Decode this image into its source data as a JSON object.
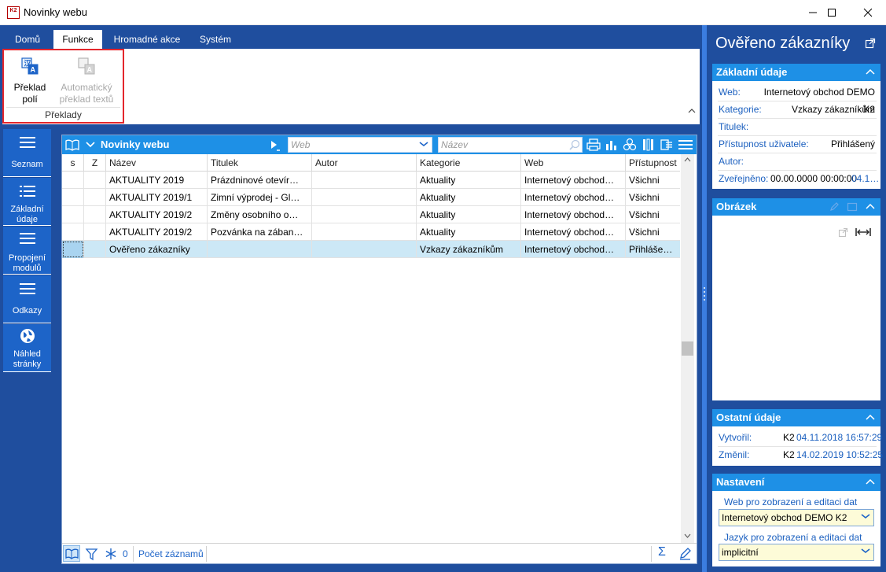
{
  "window": {
    "title": "Novinky webu",
    "app_icon_text": "K2"
  },
  "menu": {
    "tabs": [
      "Domů",
      "Funkce",
      "Hromadné akce",
      "Systém"
    ],
    "active": "Funkce"
  },
  "ribbon": {
    "buttons": [
      {
        "label1": "Překlad",
        "label2": "polí",
        "enabled": true
      },
      {
        "label1": "Automatický",
        "label2": "překlad textů",
        "enabled": false
      }
    ],
    "group_label": "Překlady"
  },
  "sidebar": {
    "items": [
      {
        "label": "Seznam",
        "icon": "menu-icon"
      },
      {
        "label1": "Základní",
        "label2": "údaje",
        "icon": "list-icon"
      },
      {
        "label1": "Propojení",
        "label2": "modulů",
        "icon": "menu-icon"
      },
      {
        "label": "Odkazy",
        "icon": "menu-icon"
      },
      {
        "label1": "Náhled",
        "label2": "stránky",
        "icon": "globe-icon"
      }
    ]
  },
  "grid": {
    "title": "Novinky webu",
    "filter_web_placeholder": "Web",
    "filter_name_placeholder": "Název",
    "columns": [
      "s",
      "Z",
      "Název",
      "Titulek",
      "Autor",
      "Kategorie",
      "Web",
      "Přístupnost"
    ],
    "rows": [
      {
        "nazev": "AKTUALITY 2019",
        "titulek": "Prázdninové otevír…",
        "autor": "",
        "kategorie": "Aktuality",
        "web": "Internetový obchod…",
        "pristupnost": "Všichni"
      },
      {
        "nazev": "AKTUALITY 2019/1",
        "titulek": "Zimní výprodej - Gl…",
        "autor": "",
        "kategorie": "Aktuality",
        "web": "Internetový obchod…",
        "pristupnost": "Všichni"
      },
      {
        "nazev": "AKTUALITY 2019/2",
        "titulek": "Změny osobního o…",
        "autor": "",
        "kategorie": "Aktuality",
        "web": "Internetový obchod…",
        "pristupnost": "Všichni"
      },
      {
        "nazev": "AKTUALITY 2019/2",
        "titulek": "Pozvánka na zában…",
        "autor": "",
        "kategorie": "Aktuality",
        "web": "Internetový obchod…",
        "pristupnost": "Všichni"
      },
      {
        "nazev": "Ověřeno zákazníky",
        "titulek": "",
        "autor": "",
        "kategorie": "Vzkazy zákazníkům",
        "web": "Internetový obchod…",
        "pristupnost": "Přihláše…"
      }
    ],
    "selected_row": 4,
    "footer": {
      "count": "0",
      "count_label": "Počet záznamů"
    }
  },
  "right_panel": {
    "title": "Ověřeno zákazníky",
    "basic": {
      "header": "Základní údaje",
      "web_label": "Web:",
      "web_value": "Internetový obchod DEMO K2",
      "category_label": "Kategorie:",
      "category_value": "Vzkazy zákazníkům",
      "title_label": "Titulek:",
      "access_label": "Přístupnost uživatele:",
      "access_value": "Přihlášený",
      "author_label": "Autor:",
      "published_label": "Zveřejněno:",
      "published_value": "00.00.0000 00:00:00",
      "published_link": "04.1…"
    },
    "image": {
      "header": "Obrázek"
    },
    "other": {
      "header": "Ostatní údaje",
      "created_label": "Vytvořil:",
      "created_user": "K2",
      "created_date": "04.11.2018 16:57:29",
      "changed_label": "Změnil:",
      "changed_user": "K2",
      "changed_date": "14.02.2019 10:52:25"
    },
    "settings": {
      "header": "Nastavení",
      "web_label": "Web pro zobrazení a editaci dat",
      "web_value": "Internetový obchod DEMO K2",
      "lang_label": "Jazyk pro zobrazení a editaci dat",
      "lang_value": "implicitní"
    }
  },
  "colors": {
    "frame": "#1f4e9e",
    "accent": "#1e90e6",
    "sidebar_item": "#1d64c8",
    "highlight": "#e3262c",
    "selected_row": "#cce8f6"
  }
}
